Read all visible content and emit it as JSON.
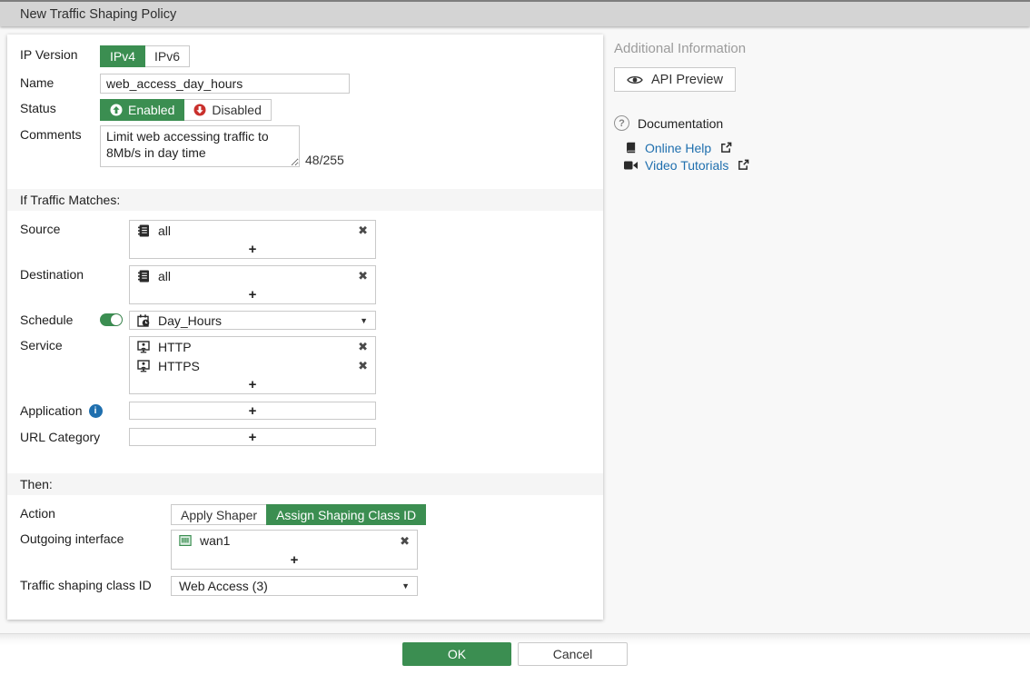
{
  "header": {
    "title": "New Traffic Shaping Policy"
  },
  "colors": {
    "green": "#3b8e51",
    "red": "#c9302c",
    "link": "#1f6fae"
  },
  "icons": {
    "remove": "✖",
    "add": "+",
    "caret": "▼",
    "info": "i",
    "question": "?"
  },
  "form": {
    "ip_version": {
      "label": "IP Version",
      "options": [
        "IPv4",
        "IPv6"
      ],
      "selected": "IPv4"
    },
    "name": {
      "label": "Name",
      "value": "web_access_day_hours"
    },
    "status": {
      "label": "Status",
      "options": [
        "Enabled",
        "Disabled"
      ],
      "selected": "Enabled"
    },
    "comments": {
      "label": "Comments",
      "value": "Limit web accessing traffic to 8Mb/s in day time",
      "counter": "48/255"
    },
    "sections": {
      "traffic": "If Traffic Matches:",
      "then": "Then:"
    },
    "source": {
      "label": "Source",
      "items": [
        "all"
      ]
    },
    "destination": {
      "label": "Destination",
      "items": [
        "all"
      ]
    },
    "schedule": {
      "label": "Schedule",
      "value": "Day_Hours",
      "enabled": true
    },
    "service": {
      "label": "Service",
      "items": [
        "HTTP",
        "HTTPS"
      ]
    },
    "application": {
      "label": "Application"
    },
    "url_category": {
      "label": "URL Category"
    },
    "action": {
      "label": "Action",
      "options": [
        "Apply Shaper",
        "Assign Shaping Class ID"
      ],
      "selected": "Assign Shaping Class ID"
    },
    "outgoing_interface": {
      "label": "Outgoing interface",
      "items": [
        "wan1"
      ]
    },
    "shaping_class": {
      "label": "Traffic shaping class ID",
      "value": "Web Access (3)"
    }
  },
  "sidebar": {
    "additional_info": "Additional Information",
    "api_preview": "API Preview",
    "documentation": "Documentation",
    "links": [
      {
        "label": "Online Help"
      },
      {
        "label": "Video Tutorials"
      }
    ]
  },
  "footer": {
    "ok": "OK",
    "cancel": "Cancel"
  }
}
